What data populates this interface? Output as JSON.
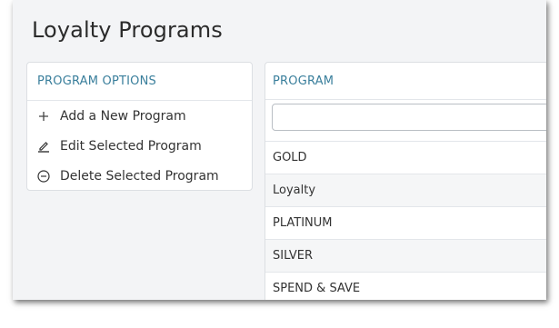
{
  "page": {
    "title": "Loyalty Programs"
  },
  "options": {
    "header": "PROGRAM OPTIONS",
    "items": [
      {
        "icon": "plus-icon",
        "label": "Add a New Program"
      },
      {
        "icon": "pencil-icon",
        "label": "Edit Selected Program"
      },
      {
        "icon": "minus-circle-icon",
        "label": "Delete Selected Program"
      }
    ]
  },
  "programs": {
    "header": "PROGRAM",
    "filter_value": "",
    "rows": [
      "GOLD",
      "Loyalty",
      "PLATINUM",
      "SILVER",
      "SPEND & SAVE"
    ]
  },
  "colors": {
    "accent": "#3a7f9c",
    "background": "#f3f4f6"
  }
}
